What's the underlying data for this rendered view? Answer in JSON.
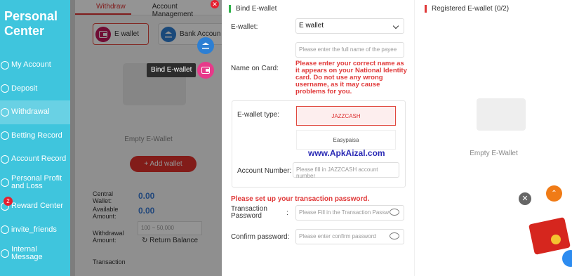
{
  "sidebar": {
    "title": "Personal Center",
    "items": [
      {
        "label": "My Account",
        "icon": "account-icon"
      },
      {
        "label": "Deposit",
        "icon": "deposit-icon"
      },
      {
        "label": "Withdrawal",
        "icon": "withdrawal-icon",
        "active": true
      },
      {
        "label": "Betting Record",
        "icon": "betting-record-icon"
      },
      {
        "label": "Account Record",
        "icon": "account-record-icon"
      },
      {
        "label": "Personal Profit and Loss",
        "icon": "profit-loss-icon"
      },
      {
        "label": "Reward Center",
        "icon": "reward-icon",
        "badge": "2"
      },
      {
        "label": "invite_friends",
        "icon": "invite-icon"
      },
      {
        "label": "Internal Message",
        "icon": "message-icon"
      }
    ]
  },
  "withdraw_panel": {
    "tabs": [
      "Withdraw",
      "Account Management"
    ],
    "ewallet_button": "E wallet",
    "bank_button": "Bank Accoun",
    "empty_text": "Empty E-Wallet",
    "add_wallet": "+ Add wallet",
    "central_wallet_label": "Central Wallet:",
    "central_wallet_value": "0.00",
    "available_label": "Available Amount:",
    "available_value": "0.00",
    "withdrawal_amount_label": "Withdrawal Amount:",
    "amount_placeholder": "100 ~ 50,000",
    "return_balance": "Return Balance",
    "transaction_label": "Transaction"
  },
  "tooltip": "Bind E-wallet",
  "form": {
    "title": "Bind E-wallet",
    "ewallet_label": "E-wallet:",
    "ewallet_value": "E wallet",
    "name_label": "Name on Card:",
    "name_placeholder": "Please enter the full name of the payee",
    "warning": "Please enter your correct name as it appears on your National Identity card. Do not use any wrong username, as it may cause problems for you.",
    "type_label": "E-wallet type:",
    "type_options": [
      "JAZZCASH",
      "Easypaisa"
    ],
    "account_label": "Account Number:",
    "account_placeholder": "Please fill in JAZZCASH account number",
    "watermark": "www.ApkAizal.com",
    "pwd_title": "Please set up your transaction password.",
    "pwd_label": "Transaction Password",
    "pwd_placeholder": "Please Fill in the Transaction Passw",
    "confirm_label": "Confirm password:",
    "confirm_placeholder": "Please enter confirm password"
  },
  "registered": {
    "title": "Registered E-wallet",
    "count": "(0/2)",
    "empty_text": "Empty E-Wallet"
  },
  "colors": {
    "sidebar": "#3fc5dd",
    "accent": "#e0312c",
    "warning": "#e03939"
  }
}
